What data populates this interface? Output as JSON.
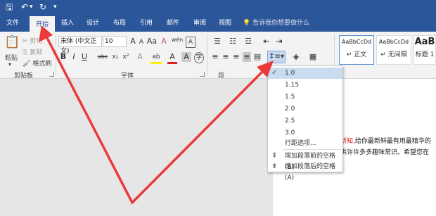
{
  "qat": {
    "save": "🖫",
    "undo": "↶",
    "redo": "↻",
    "more": "▾"
  },
  "tabs": [
    "文件",
    "开始",
    "插入",
    "设计",
    "布局",
    "引用",
    "邮件",
    "审阅",
    "视图"
  ],
  "tellme": "告诉我你想要做什么",
  "clipboard": {
    "paste": "粘贴",
    "cut": "剪切",
    "copy": "复制",
    "format_painter": "格式刷",
    "group": "剪贴板"
  },
  "font": {
    "name": "宋体 (中文正文)",
    "size": "10",
    "grow": "A",
    "shrink": "A",
    "case": "Aa",
    "clear": "A",
    "wen": "wén",
    "bold": "B",
    "italic": "I",
    "underline": "U",
    "strike": "abc",
    "sub": "x₂",
    "sup": "x²",
    "effects": "A",
    "highlight": "ab",
    "color": "A",
    "shading": "A",
    "border": "A",
    "group": "字体"
  },
  "paragraph": {
    "group": "段"
  },
  "styles": [
    {
      "sample": "AaBbCcDd",
      "name": "正文"
    },
    {
      "sample": "AaBbCcDd",
      "name": "无间隔"
    },
    {
      "sample": "AaB",
      "name": "标题 1"
    }
  ],
  "menu": {
    "items": [
      "1.0",
      "1.15",
      "1.5",
      "2.0",
      "2.5",
      "3.0"
    ],
    "options": "行距选项...",
    "add_before": "增加段落前的空格(B)",
    "add_after": "增加段落后的空格(A)",
    "check": "✓"
  },
  "document": {
    "line1_red": "新知,",
    "line1": "给你最新鲜最有用最精华的",
    "line2": "供许许多多趣味常识。希望您在"
  },
  "colors": {
    "accent": "#2b579a",
    "arrow": "#ea3a3a",
    "red_text": "#e02020"
  }
}
